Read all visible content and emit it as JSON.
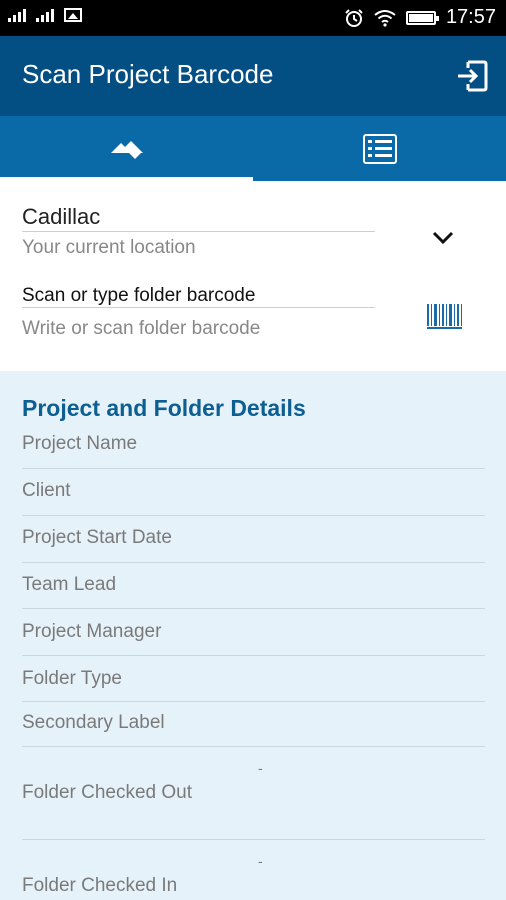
{
  "status_bar": {
    "time": "17:57",
    "signal_label_1": "ııll",
    "signal_label_2": "ııll",
    "icons": [
      "signal-icon",
      "signal-icon",
      "image-icon",
      "alarm-icon",
      "wifi-icon",
      "battery-icon"
    ]
  },
  "app_bar": {
    "title": "Scan Project Barcode",
    "exit_icon": "exit-icon"
  },
  "tabs": [
    {
      "icon": "scan-tab-icon",
      "selected": true
    },
    {
      "icon": "list-tab-icon",
      "selected": false
    }
  ],
  "location": {
    "value": "Cadillac",
    "hint": "Your current location"
  },
  "barcode": {
    "label": "Scan or type folder barcode",
    "placeholder": "Write or scan folder barcode"
  },
  "details": {
    "title": "Project and Folder Details",
    "rows": [
      {
        "label": "Project Name",
        "value": ""
      },
      {
        "label": "Client",
        "value": ""
      },
      {
        "label": "Project Start Date",
        "value": ""
      },
      {
        "label": "Team Lead",
        "value": ""
      },
      {
        "label": "Project Manager",
        "value": ""
      },
      {
        "label": "Folder Type",
        "value": ""
      },
      {
        "label": "Secondary Label",
        "value": ""
      },
      {
        "label": "Folder Checked Out",
        "value": "-"
      },
      {
        "label": "Folder Checked In",
        "value": "-"
      }
    ]
  },
  "colors": {
    "app_bar": "#034f84",
    "tab_bar": "#0a6aa8",
    "details_bg": "#e6f2fa",
    "details_title": "#0d5f92"
  }
}
